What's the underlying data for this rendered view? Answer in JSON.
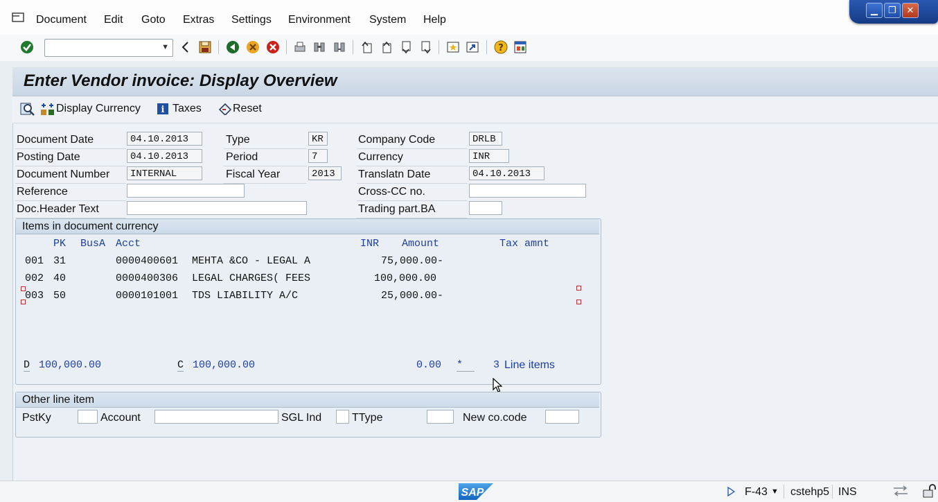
{
  "menu": [
    "Document",
    "Edit",
    "Goto",
    "Extras",
    "Settings",
    "Environment",
    "System",
    "Help"
  ],
  "window_controls": {
    "minimize": "▁",
    "restore": "❐",
    "close": "✕"
  },
  "toolbar": {
    "command_field_value": "",
    "icons": [
      "enter-icon",
      "back-arrow-icon",
      "save-icon",
      "back-icon",
      "exit-icon",
      "cancel-icon",
      "print-icon",
      "find-icon",
      "find-next-icon",
      "first-page-icon",
      "previous-page-icon",
      "next-page-icon",
      "last-page-icon",
      "create-session-icon",
      "create-shortcut-icon",
      "help-icon",
      "layout-menu-icon"
    ]
  },
  "title": "Enter Vendor invoice: Display Overview",
  "app_toolbar": {
    "display_currency": "Display Currency",
    "taxes": "Taxes",
    "reset": "Reset"
  },
  "header": {
    "document_date": {
      "label": "Document Date",
      "value": "04.10.2013"
    },
    "posting_date": {
      "label": "Posting Date",
      "value": "04.10.2013"
    },
    "document_number": {
      "label": "Document Number",
      "value": "INTERNAL"
    },
    "reference": {
      "label": "Reference",
      "value": ""
    },
    "doc_header_text": {
      "label": "Doc.Header Text",
      "value": ""
    },
    "type": {
      "label": "Type",
      "value": "KR"
    },
    "period": {
      "label": "Period",
      "value": "7"
    },
    "fiscal_year": {
      "label": "Fiscal Year",
      "value": "2013"
    },
    "company_code": {
      "label": "Company Code",
      "value": "DRLB"
    },
    "currency": {
      "label": "Currency",
      "value": "INR"
    },
    "translatn_date": {
      "label": "Translatn Date",
      "value": "04.10.2013"
    },
    "cross_cc_no": {
      "label": "Cross-CC no.",
      "value": ""
    },
    "trading_part_ba": {
      "label": "Trading part.BA",
      "value": ""
    }
  },
  "items": {
    "group_title": "Items in document currency",
    "columns": {
      "pk": "PK",
      "busa": "BusA",
      "acct": "Acct",
      "currency": "INR",
      "amount": "Amount",
      "tax": "Tax amnt"
    },
    "rows": [
      {
        "item": "001",
        "pk": "31",
        "acct": "0000400601",
        "desc": "MEHTA &CO - LEGAL A",
        "amount": "75,000.00-"
      },
      {
        "item": "002",
        "pk": "40",
        "acct": "0000400306",
        "desc": "LEGAL CHARGES( FEES",
        "amount": "100,000.00"
      },
      {
        "item": "003",
        "pk": "50",
        "acct": "0000101001",
        "desc": "TDS LIABILITY A/C",
        "amount": "25,000.00-"
      }
    ],
    "totals": {
      "debit_label": "D",
      "debit": "100,000.00",
      "credit_label": "C",
      "credit": "100,000.00",
      "balance": "0.00",
      "balance_flag": "*",
      "line_count": "3",
      "line_items_label": "Line items"
    }
  },
  "other_line_item": {
    "group_title": "Other line item",
    "pstky_label": "PstKy",
    "account_label": "Account",
    "sgl_ind_label": "SGL Ind",
    "ttype_label": "TType",
    "new_co_code_label": "New co.code"
  },
  "status": {
    "logo": "SAP",
    "transaction": "F-43",
    "server": "cstehp5",
    "mode": "INS"
  }
}
